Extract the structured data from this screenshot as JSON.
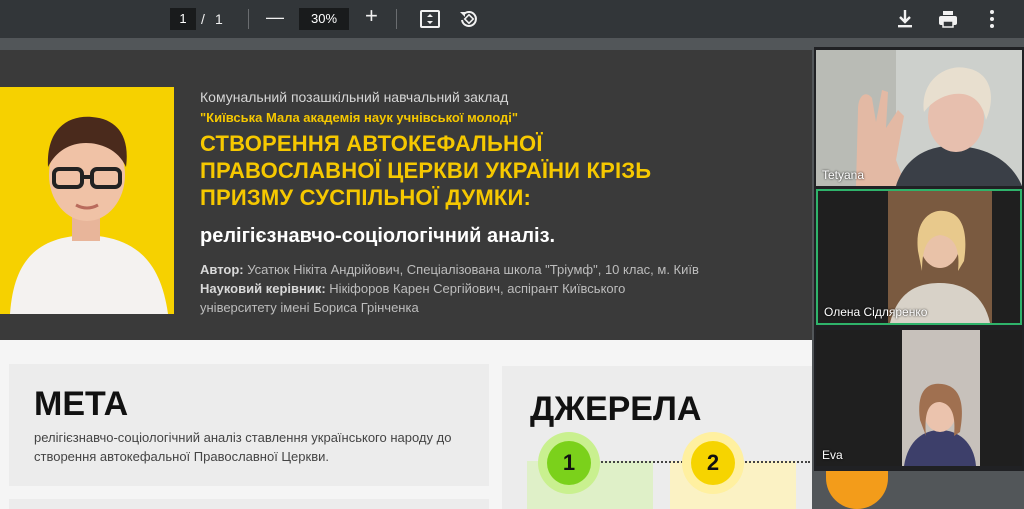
{
  "toolbar": {
    "page_current": "1",
    "page_separator": "/",
    "page_total": "1",
    "zoom_minus": "—",
    "zoom_value": "30%",
    "zoom_plus": "+"
  },
  "poster": {
    "institution": "Комунальний позашкільний навчальний заклад",
    "academy": "\"Київська Мала академія наук учнівської молоді\"",
    "title_lines": [
      "СТВОРЕННЯ АВТОКЕФАЛЬНОЇ",
      "ПРАВОСЛАВНОЇ ЦЕРКВИ УКРАЇНИ КРІЗЬ",
      "ПРИЗМУ СУСПІЛЬНОЇ ДУМКИ:"
    ],
    "subtitle": "релігієзнавчо-соціологічний аналіз.",
    "author_label": "Автор:",
    "author_value": "Усатюк Нікіта Андрійович, Спеціалізована школа \"Тріумф\", 10 клас, м. Київ",
    "advisor_label": "Науковий керівник:",
    "advisor_value": "Нікіфоров Карен Сергійович, аспірант Київського",
    "advisor_value2": "університету імені Бориса Грінченка",
    "goal_heading": "МЕТА",
    "goal_text": "релігієзнавчо-соціологічний аналіз ставлення українського народу до створення автокефальної Православної Церкви.",
    "sources_heading": "ДЖЕРЕЛА",
    "steps": [
      "1",
      "2"
    ]
  },
  "participants": [
    {
      "name": "Tetyana"
    },
    {
      "name": "Олена Сідляренко"
    },
    {
      "name": "Eva"
    }
  ],
  "colors": {
    "accent_yellow": "#f6c800",
    "green_step": "#7bd11b",
    "yellow_step": "#f6d400",
    "orange_step": "#f39c1a"
  }
}
